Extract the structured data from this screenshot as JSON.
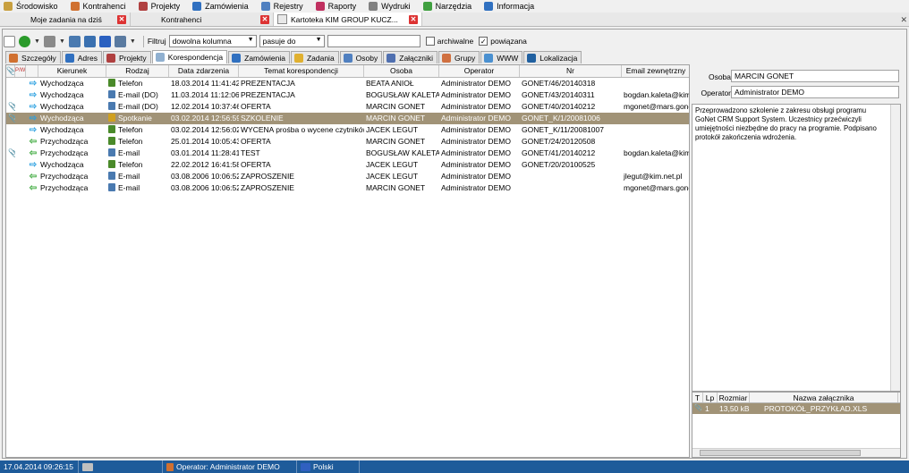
{
  "menu": [
    {
      "label": "Środowisko",
      "icon": "cube-icon",
      "color": "#c8a040"
    },
    {
      "label": "Kontrahenci",
      "icon": "person-icon",
      "color": "#d07030"
    },
    {
      "label": "Projekty",
      "icon": "projects-icon",
      "color": "#b04040"
    },
    {
      "label": "Zamówienia",
      "icon": "globe-icon",
      "color": "#3070c0"
    },
    {
      "label": "Rejestry",
      "icon": "register-icon",
      "color": "#5080c0"
    },
    {
      "label": "Raporty",
      "icon": "chart-icon",
      "color": "#c03060"
    },
    {
      "label": "Wydruki",
      "icon": "printer-icon",
      "color": "#808080"
    },
    {
      "label": "Narzędzia",
      "icon": "tools-icon",
      "color": "#40a040"
    },
    {
      "label": "Informacja",
      "icon": "info-icon",
      "color": "#3070c0"
    }
  ],
  "doc_tabs": [
    {
      "label": "Moje zadania na dziś"
    },
    {
      "label": "Kontrahenci"
    },
    {
      "label": "Kartoteka KIM GROUP KUCZ..."
    }
  ],
  "window_close": "✕",
  "toolbar": {
    "filter_label": "Filtruj",
    "filter_column": "dowolna kolumna",
    "filter_mode": "pasuje do",
    "filter_text": "",
    "archived_label": "archiwalne",
    "linked_label": "powiązana",
    "linked_checked": "✓"
  },
  "tabs": [
    {
      "label": "Szczegóły",
      "color": "#d07030"
    },
    {
      "label": "Adres",
      "color": "#3070c0"
    },
    {
      "label": "Projekty",
      "color": "#b04040"
    },
    {
      "label": "Korespondencja",
      "color": "#90b0d0"
    },
    {
      "label": "Zamówienia",
      "color": "#3070c0"
    },
    {
      "label": "Zadania",
      "color": "#e0b030"
    },
    {
      "label": "Osoby",
      "color": "#5080c0"
    },
    {
      "label": "Załączniki",
      "color": "#5070b0"
    },
    {
      "label": "Grupy",
      "color": "#d07040"
    },
    {
      "label": "WWW",
      "color": "#4a90d0"
    },
    {
      "label": "Lokalizacja",
      "color": "#2060a0"
    }
  ],
  "grid": {
    "headers": [
      "Kierunek",
      "Rodzaj",
      "Data zdarzenia",
      "Temat korespondencji",
      "Osoba",
      "Operator",
      "Nr",
      "Email zewnętrzny"
    ],
    "rows": [
      {
        "att": "",
        "dir": "out",
        "kierunek": "Wychodząca",
        "rodzaj": "Telefon",
        "rcolor": "#4a8a2a",
        "data": "18.03.2014 11:41:42",
        "temat": "PREZENTACJA",
        "osoba": "BEATA ANIOŁ",
        "operator": "Administrator DEMO",
        "nr": "GONET/46/20140318",
        "email": ""
      },
      {
        "att": "",
        "dir": "out",
        "kierunek": "Wychodząca",
        "rodzaj": "E-mail (DO)",
        "rcolor": "#4a7ab0",
        "data": "11.03.2014 11:12:06",
        "temat": "PREZENTACJA",
        "osoba": "BOGUSŁAW KALETA",
        "operator": "Administrator DEMO",
        "nr": "GONET/43/20140311",
        "email": "bogdan.kaleta@kim.pl"
      },
      {
        "att": "📎",
        "dir": "out",
        "kierunek": "Wychodząca",
        "rodzaj": "E-mail (DO)",
        "rcolor": "#4a7ab0",
        "data": "12.02.2014 10:37:46",
        "temat": "OFERTA",
        "osoba": "MARCIN GONET",
        "operator": "Administrator DEMO",
        "nr": "GONET/40/20140212",
        "email": "mgonet@mars.gonet"
      },
      {
        "att": "📎",
        "dir": "out",
        "kierunek": "Wychodząca",
        "rodzaj": "Spotkanie",
        "rcolor": "#d0a020",
        "data": "03.02.2014 12:56:59",
        "temat": "SZKOLENIE",
        "osoba": "MARCIN GONET",
        "operator": "Administrator DEMO",
        "nr": "GONET_K/1/20081006",
        "email": ""
      },
      {
        "att": "",
        "dir": "out",
        "kierunek": "Wychodząca",
        "rodzaj": "Telefon",
        "rcolor": "#4a8a2a",
        "data": "03.02.2014 12:56:02",
        "temat": "WYCENA prośba o wycene czytników",
        "osoba": "JACEK LEGUT",
        "operator": "Administrator DEMO",
        "nr": "GONET_K/11/20081007",
        "email": ""
      },
      {
        "att": "",
        "dir": "in",
        "kierunek": "Przychodząca",
        "rodzaj": "Telefon",
        "rcolor": "#4a8a2a",
        "data": "25.01.2014 10:05:43",
        "temat": "OFERTA",
        "osoba": "MARCIN GONET",
        "operator": "Administrator DEMO",
        "nr": "GONET/24/20120508",
        "email": ""
      },
      {
        "att": "📎",
        "dir": "in",
        "kierunek": "Przychodząca",
        "rodzaj": "E-mail",
        "rcolor": "#4a7ab0",
        "data": "03.01.2014 11:28:41",
        "temat": "TEST",
        "osoba": "BOGUSŁAW KALETA",
        "operator": "Administrator DEMO",
        "nr": "GONET/41/20140212",
        "email": "bogdan.kaleta@kim.pl"
      },
      {
        "att": "",
        "dir": "out",
        "kierunek": "Wychodząca",
        "rodzaj": "Telefon",
        "rcolor": "#4a8a2a",
        "data": "22.02.2012 16:41:58",
        "temat": "OFERTA",
        "osoba": "JACEK LEGUT",
        "operator": "Administrator DEMO",
        "nr": "GONET/20/20100525",
        "email": ""
      },
      {
        "att": "",
        "dir": "in",
        "kierunek": "Przychodząca",
        "rodzaj": "E-mail",
        "rcolor": "#4a7ab0",
        "data": "03.08.2006 10:06:52",
        "temat": "ZAPROSZENIE",
        "osoba": "JACEK LEGUT",
        "operator": "Administrator DEMO",
        "nr": "",
        "email": "jlegut@kim.net.pl"
      },
      {
        "att": "",
        "dir": "in",
        "kierunek": "Przychodząca",
        "rodzaj": "E-mail",
        "rcolor": "#4a7ab0",
        "data": "03.08.2006 10:06:52",
        "temat": "ZAPROSZENIE",
        "osoba": "MARCIN GONET",
        "operator": "Administrator DEMO",
        "nr": "",
        "email": "mgonet@mars.gonet"
      }
    ],
    "selected_index": 3
  },
  "detail": {
    "osoba_label": "Osoba",
    "osoba_value": "MARCIN GONET",
    "operator_label": "Operator",
    "operator_value": "Administrator DEMO",
    "memo": "Przeprowadzono szkolenie z zakresu obsługi programu GoNet CRM Support System. Uczestnicy przećwiczyli umiejętności niezbędne do pracy na programie. Podpisano protokół zakończenia wdrożenia."
  },
  "attachments": {
    "headers": [
      "T",
      "Lp",
      "Rozmiar",
      "Nazwa załącznika"
    ],
    "rows": [
      {
        "lp": "1",
        "rozmiar": "13,50 kB",
        "nazwa": "PROTOKÓŁ_PRZYKŁAD.XLS"
      }
    ]
  },
  "status": {
    "datetime": "17.04.2014 09:26:15",
    "operator": "Operator: Administrator DEMO",
    "language": "Polski"
  }
}
